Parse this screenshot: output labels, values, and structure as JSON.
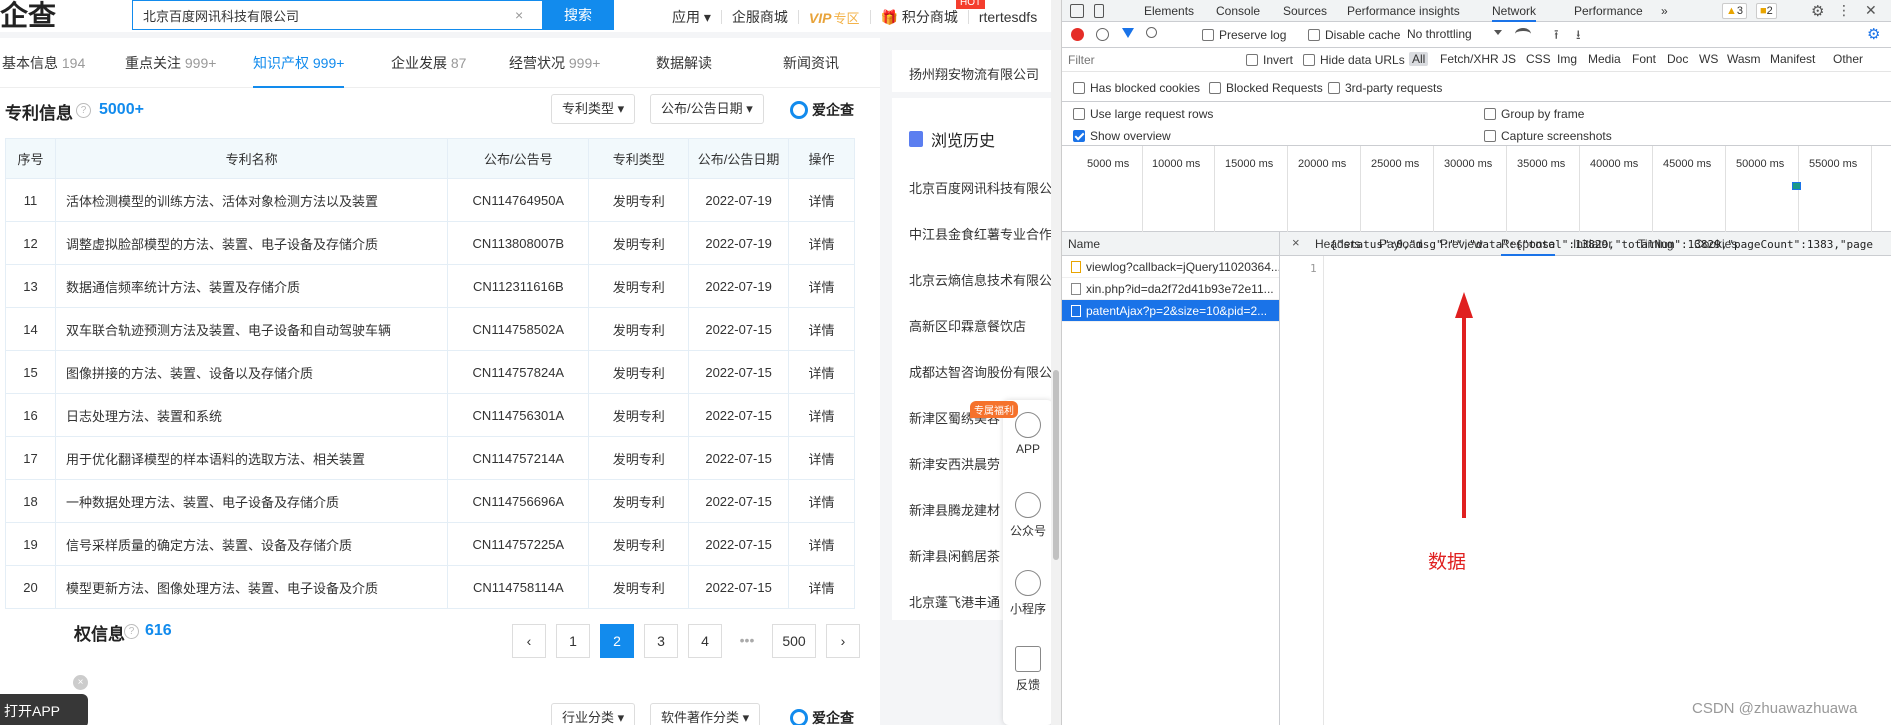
{
  "header": {
    "logo_text": "企查",
    "search_value": "北京百度网讯科技有限公司",
    "search_clear": "×",
    "search_button": "搜索",
    "nav": {
      "app": "应用",
      "enterprise_mall": "企服商城",
      "vip": "VIP",
      "vip_sub": "专区",
      "points_mall": "积分商城",
      "hot": "HOT",
      "user": "rtertesdfs"
    }
  },
  "tabs": [
    {
      "label": "基本信息",
      "count": "194"
    },
    {
      "label": "重点关注",
      "count": "999+"
    },
    {
      "label": "知识产权",
      "count": "999+"
    },
    {
      "label": "企业发展",
      "count": "87"
    },
    {
      "label": "经营状况",
      "count": "999+"
    },
    {
      "label": "数据解读",
      "count": ""
    },
    {
      "label": "新闻资讯",
      "count": ""
    }
  ],
  "patent_section": {
    "title": "专利信息",
    "help": "?",
    "count": "5000+",
    "filters": [
      "专利类型",
      "公布/公告日期"
    ],
    "brand": "爱企查",
    "columns": [
      "序号",
      "专利名称",
      "公布/公告号",
      "专利类型",
      "公布/公告日期",
      "操作"
    ],
    "rows": [
      {
        "idx": "11",
        "name": "活体检测模型的训练方法、活体对象检测方法以及装置",
        "pub": "CN114764950A",
        "type": "发明专利",
        "date": "2022-07-19",
        "op": "详情"
      },
      {
        "idx": "12",
        "name": "调整虚拟脸部模型的方法、装置、电子设备及存储介质",
        "pub": "CN113808007B",
        "type": "发明专利",
        "date": "2022-07-19",
        "op": "详情"
      },
      {
        "idx": "13",
        "name": "数据通信频率统计方法、装置及存储介质",
        "pub": "CN112311616B",
        "type": "发明专利",
        "date": "2022-07-19",
        "op": "详情"
      },
      {
        "idx": "14",
        "name": "双车联合轨迹预测方法及装置、电子设备和自动驾驶车辆",
        "pub": "CN114758502A",
        "type": "发明专利",
        "date": "2022-07-15",
        "op": "详情"
      },
      {
        "idx": "15",
        "name": "图像拼接的方法、装置、设备以及存储介质",
        "pub": "CN114757824A",
        "type": "发明专利",
        "date": "2022-07-15",
        "op": "详情"
      },
      {
        "idx": "16",
        "name": "日志处理方法、装置和系统",
        "pub": "CN114756301A",
        "type": "发明专利",
        "date": "2022-07-15",
        "op": "详情"
      },
      {
        "idx": "17",
        "name": "用于优化翻译模型的样本语料的选取方法、相关装置",
        "pub": "CN114757214A",
        "type": "发明专利",
        "date": "2022-07-15",
        "op": "详情"
      },
      {
        "idx": "18",
        "name": "一种数据处理方法、装置、电子设备及存储介质",
        "pub": "CN114756696A",
        "type": "发明专利",
        "date": "2022-07-15",
        "op": "详情"
      },
      {
        "idx": "19",
        "name": "信号采样质量的确定方法、装置、设备及存储介质",
        "pub": "CN114757225A",
        "type": "发明专利",
        "date": "2022-07-15",
        "op": "详情"
      },
      {
        "idx": "20",
        "name": "模型更新方法、图像处理方法、装置、电子设备及介质",
        "pub": "CN114758114A",
        "type": "发明专利",
        "date": "2022-07-15",
        "op": "详情"
      }
    ],
    "pager": {
      "prev": "‹",
      "pages": [
        "1",
        "2",
        "3",
        "4"
      ],
      "dots": "•••",
      "last": "500",
      "next": "›",
      "active": "2"
    }
  },
  "copyright_section": {
    "title": "权信息",
    "help": "?",
    "count": "616",
    "filters": [
      "行业分类",
      "软件著作分类"
    ],
    "brand": "爱企查"
  },
  "open_app": "打开APP",
  "open_app_close": "×",
  "side": {
    "top_item": "扬州翔安物流有限公司",
    "history_title": "浏览历史",
    "history": [
      "北京百度网讯科技有限公",
      "中江县金食红薯专业合作",
      "北京云熵信息技术有限公",
      "高新区印霖意餐饮店",
      "成都达智咨询股份有限公",
      "新津区蜀绣美容",
      "新津安西洪晨劳",
      "新津县腾龙建材",
      "新津县闲鹤居茶",
      "北京蓬飞港丰通"
    ]
  },
  "float_bar": {
    "badge": "专属福利",
    "items": [
      "APP",
      "公众号",
      "小程序",
      "反馈"
    ]
  },
  "devtools": {
    "tabs": [
      "Elements",
      "Console",
      "Sources",
      "Performance insights",
      "Network",
      "Performance",
      "»"
    ],
    "active_tab": "Network",
    "warnings": "3",
    "errors": "2",
    "toolbar": {
      "preserve_log": "Preserve log",
      "disable_cache": "Disable cache",
      "throttling": "No throttling"
    },
    "filter": {
      "placeholder": "Filter",
      "invert": "Invert",
      "hide_data_urls": "Hide data URLs",
      "types": [
        "All",
        "Fetch/XHR",
        "JS",
        "CSS",
        "Img",
        "Media",
        "Font",
        "Doc",
        "WS",
        "Wasm",
        "Manifest",
        "Other"
      ]
    },
    "row3": {
      "blocked_cookies": "Has blocked cookies",
      "blocked_requests": "Blocked Requests",
      "third_party": "3rd-party requests"
    },
    "row4": {
      "large_rows": "Use large request rows",
      "group_by_frame": "Group by frame",
      "show_overview": "Show overview",
      "capture_screenshots": "Capture screenshots"
    },
    "overview_labels": [
      "5000 ms",
      "10000 ms",
      "15000 ms",
      "20000 ms",
      "25000 ms",
      "30000 ms",
      "35000 ms",
      "40000 ms",
      "45000 ms",
      "50000 ms",
      "55000 ms"
    ],
    "name_header": "Name",
    "requests": [
      "viewlog?callback=jQuery11020364...",
      "xin.php?id=da2f72d41b93e72e11...",
      "patentAjax?p=2&size=10&pid=2..."
    ],
    "detail_close": "×",
    "detail_tabs": [
      "Headers",
      "Payload",
      "Preview",
      "Response",
      "Initiator",
      "Timing",
      "Cookies"
    ],
    "active_detail_tab": "Response",
    "line_number": "1",
    "response": "{\"status\":0,\"msg\":\"\",\"data\":{\"total\":13829,\"totalNum\":13829,\"pageCount\":1383,\"page"
  },
  "annotation": "数据",
  "watermark": "CSDN @zhuawazhuawa",
  "colors": {
    "accent": "#128bed",
    "devtools_blue": "#1a73e8",
    "annotation_red": "#e02020"
  }
}
